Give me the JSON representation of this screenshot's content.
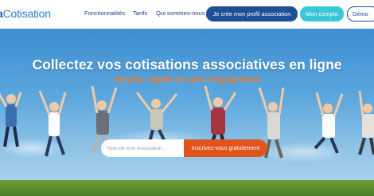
{
  "header": {
    "logo": {
      "mark": "a",
      "text": "Cotisation"
    },
    "nav": [
      "Fonctionnalités",
      "Tarifs",
      "Qui sommes-nous"
    ],
    "cta_primary": "Je crée mon profil association",
    "cta_account": "Mon compte",
    "cta_demo": "Démo"
  },
  "hero": {
    "title": "Collectez vos cotisations associatives en ligne",
    "subtitle": "Simple, rapide et sans engagement",
    "signup": {
      "placeholder": "Nom de mon Association...",
      "button_label": "Inscrivez-vous gratuitement"
    }
  },
  "colors": {
    "brand_blue": "#1f4f96",
    "accent_cyan": "#3cc7d8",
    "accent_orange": "#e1541e",
    "subtitle_orange": "#f07c2e",
    "sky": "#5aa6dd",
    "grass": "#5b8a2d"
  }
}
